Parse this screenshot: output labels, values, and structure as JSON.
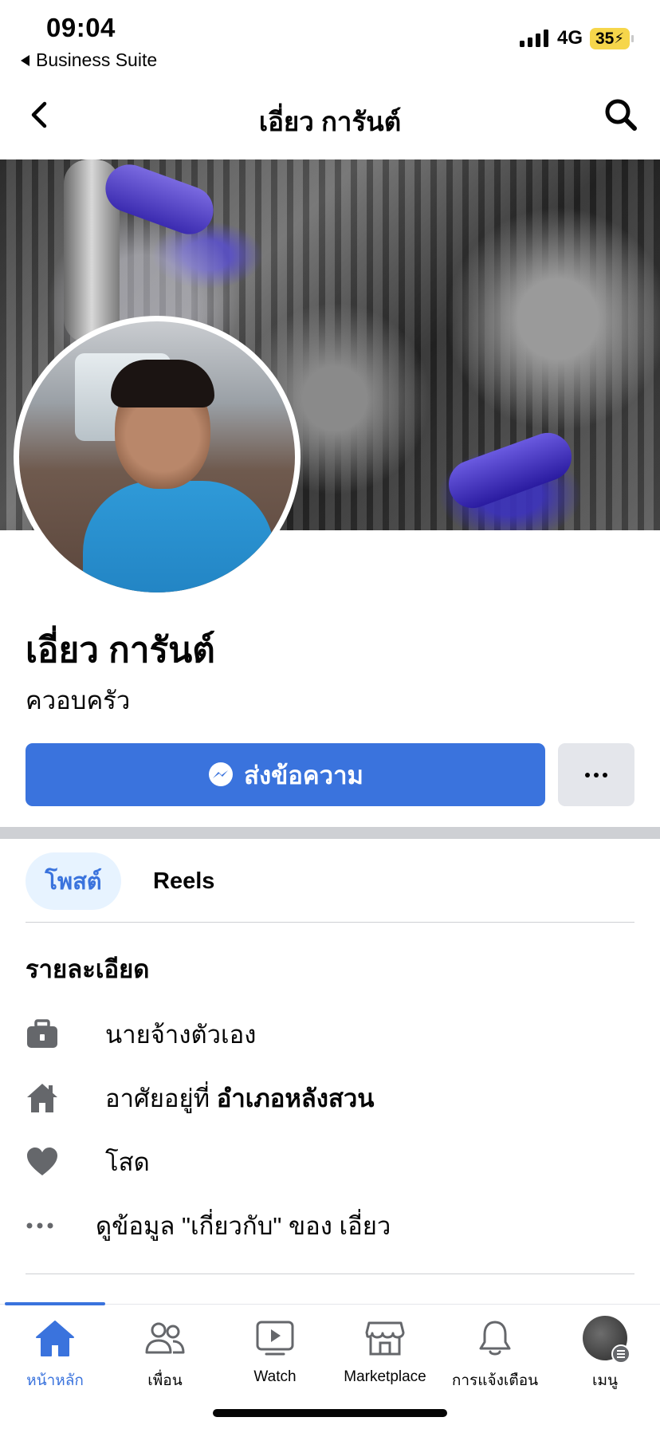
{
  "status_bar": {
    "time": "09:04",
    "back_app": "Business Suite",
    "network": "4G",
    "battery": "35"
  },
  "header": {
    "title": "เอี่ยว การันต์"
  },
  "profile": {
    "name": "เอี่ยว การันต์",
    "subtitle": "ควอบครัว",
    "message_button": "ส่งข้อความ"
  },
  "tabs": [
    {
      "label": "โพสต์",
      "active": true
    },
    {
      "label": "Reels",
      "active": false
    }
  ],
  "details": {
    "title": "รายละเอียด",
    "work": "นายจ้างตัวเอง",
    "lives_prefix": "อาศัยอยู่ที่ ",
    "lives_place": "อำเภอหลังสวน",
    "relationship": "โสด",
    "about_link": "ดูข้อมูล \"เกี่ยวกับ\" ของ เอี่ยว"
  },
  "bottom_nav": [
    {
      "label": "หน้าหลัก",
      "icon": "home-icon",
      "active": true
    },
    {
      "label": "เพื่อน",
      "icon": "friends-icon",
      "active": false
    },
    {
      "label": "Watch",
      "icon": "watch-icon",
      "active": false
    },
    {
      "label": "Marketplace",
      "icon": "marketplace-icon",
      "active": false
    },
    {
      "label": "การแจ้งเตือน",
      "icon": "bell-icon",
      "active": false
    },
    {
      "label": "เมนู",
      "icon": "menu-avatar",
      "active": false
    }
  ],
  "colors": {
    "accent": "#3a73dd",
    "accent_light": "#e7f3ff",
    "text": "#050505",
    "secondary_btn": "#e4e6eb",
    "divider": "#ced0d4",
    "icon_gray": "#65676b",
    "battery": "#f6d64b"
  }
}
